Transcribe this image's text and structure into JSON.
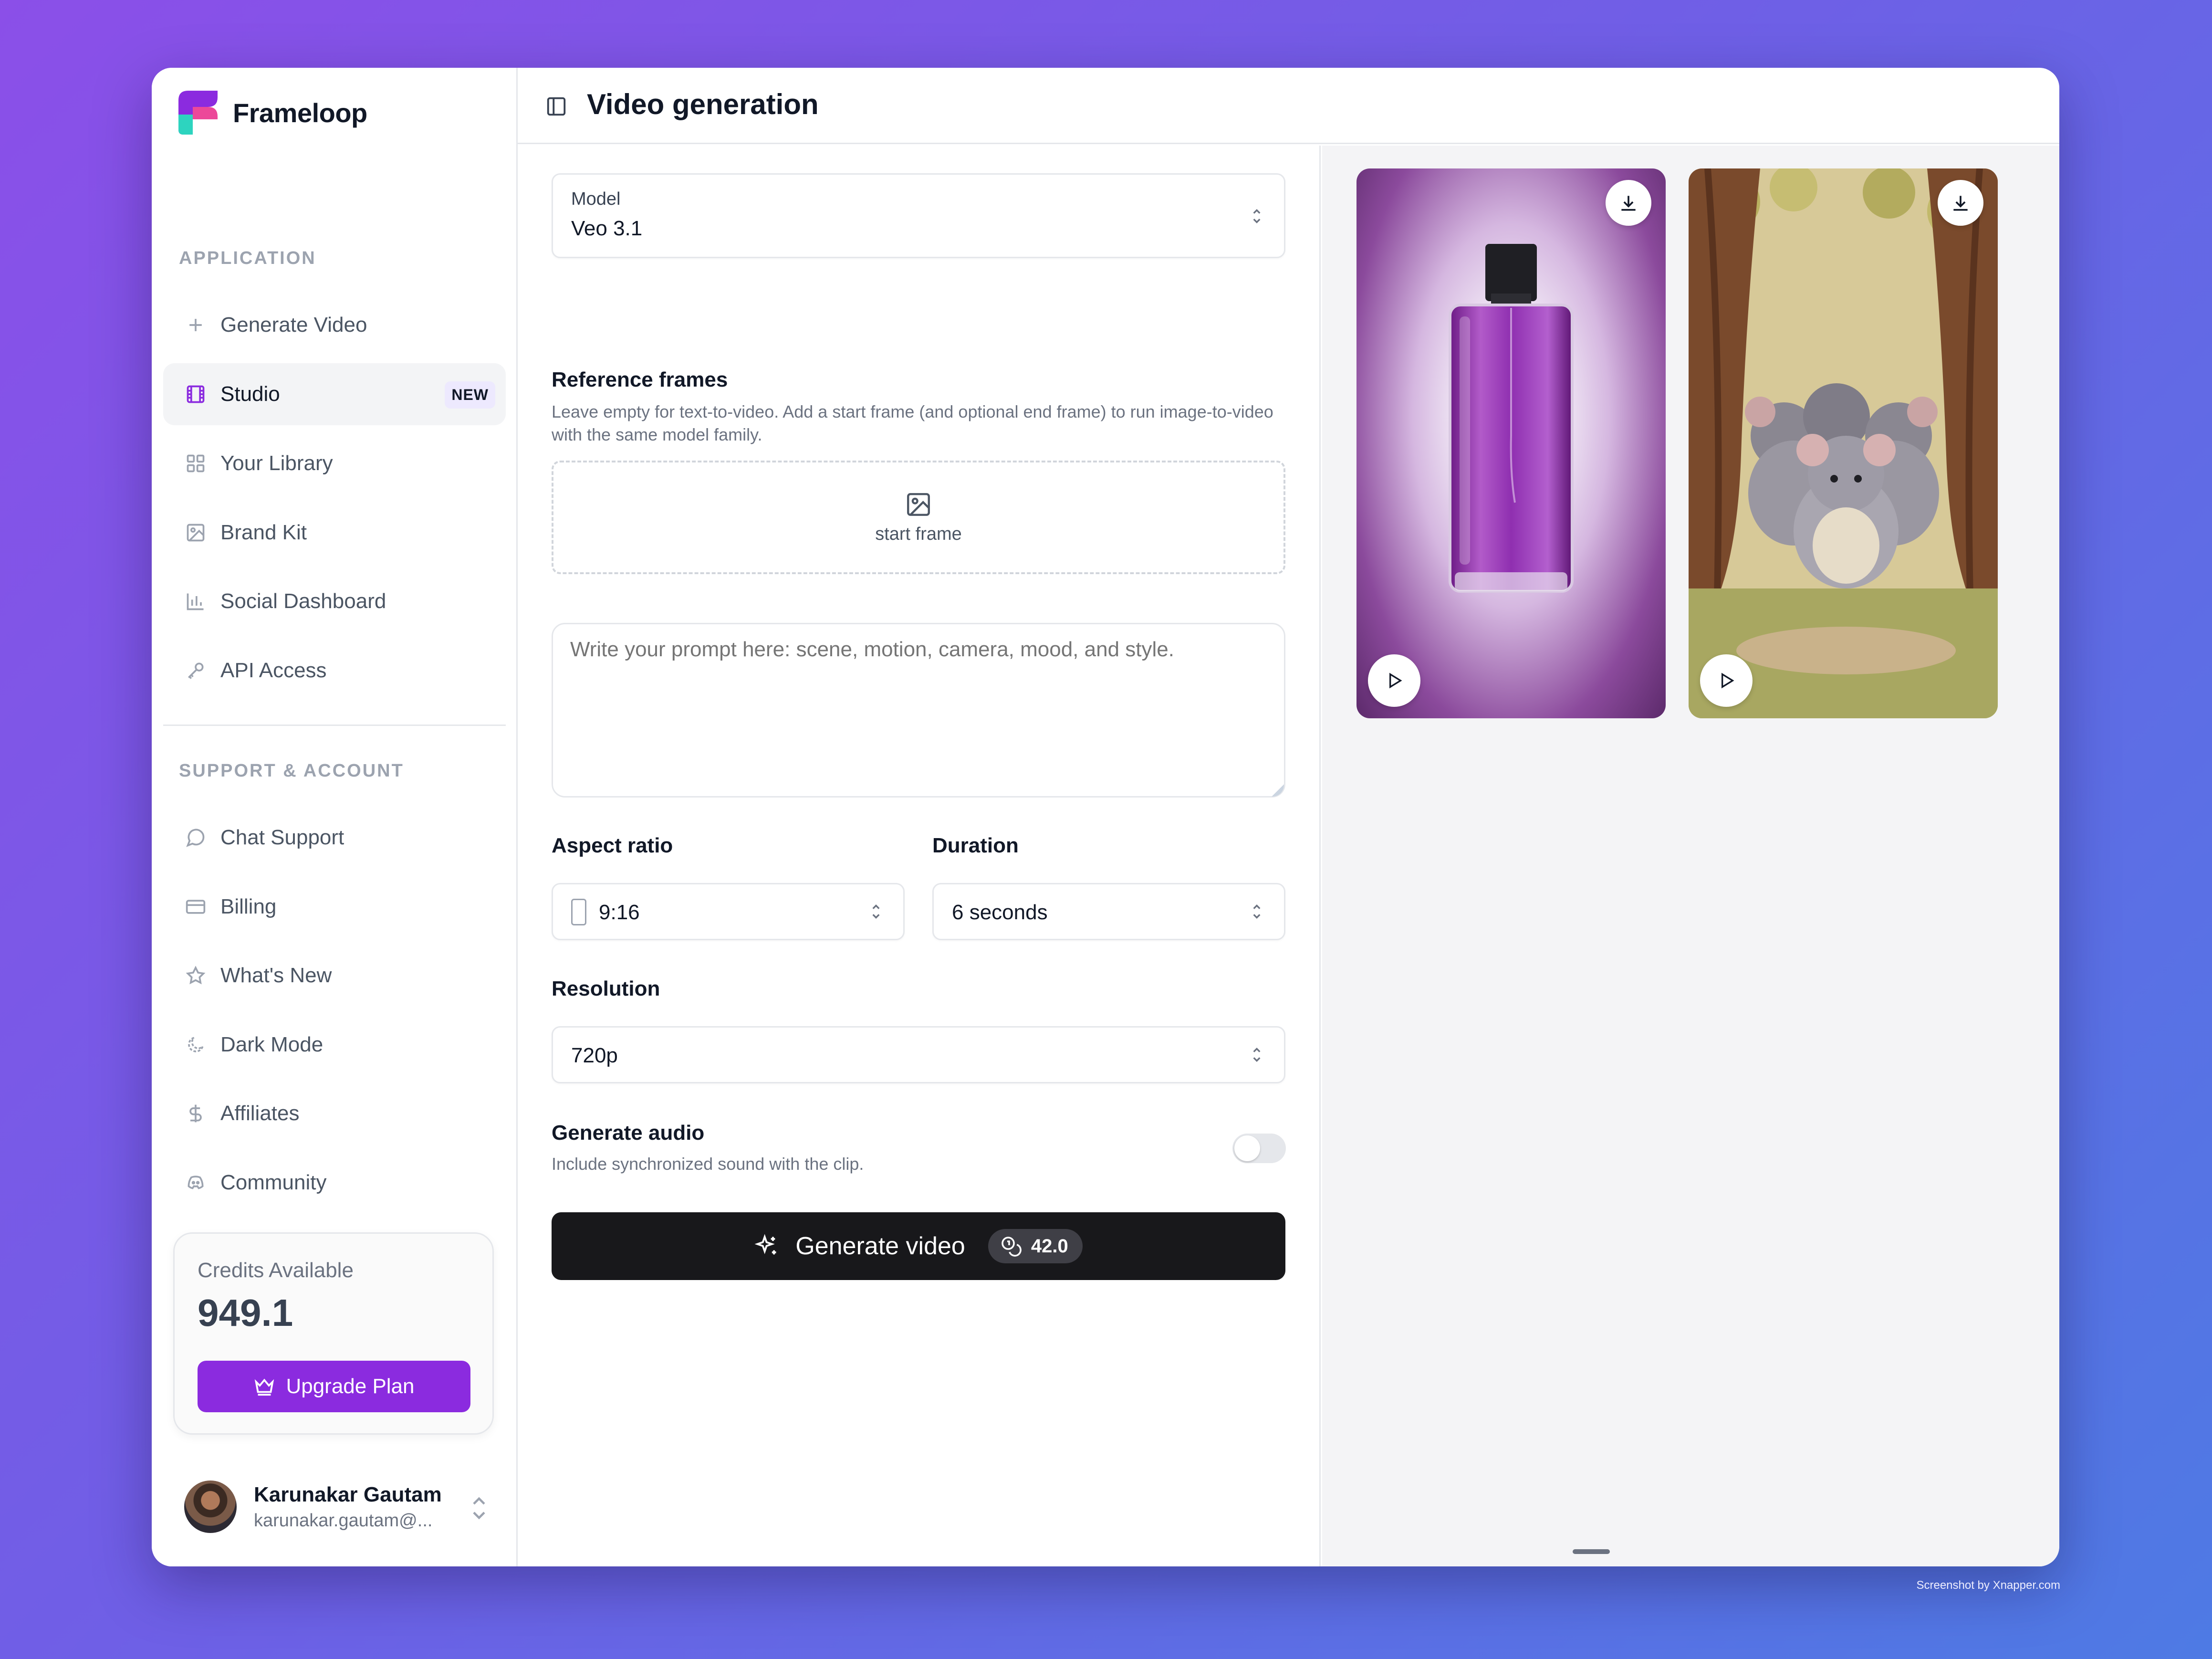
{
  "app": {
    "name": "Frameloop"
  },
  "sidebar": {
    "application_label": "APPLICATION",
    "items": [
      {
        "label": "Generate Video",
        "icon": "plus-icon"
      },
      {
        "label": "Studio",
        "icon": "film-icon",
        "badge": "NEW"
      },
      {
        "label": "Your Library",
        "icon": "grid-icon"
      },
      {
        "label": "Brand Kit",
        "icon": "image-icon"
      },
      {
        "label": "Social Dashboard",
        "icon": "bar-chart-icon"
      },
      {
        "label": "API Access",
        "icon": "key-icon"
      }
    ],
    "support_label": "SUPPORT & ACCOUNT",
    "support_items": [
      {
        "label": "Chat Support",
        "icon": "chat-icon"
      },
      {
        "label": "Billing",
        "icon": "credit-card-icon"
      },
      {
        "label": "What's New",
        "icon": "star-icon"
      },
      {
        "label": "Dark Mode",
        "icon": "moon-icon"
      },
      {
        "label": "Affiliates",
        "icon": "dollar-icon"
      },
      {
        "label": "Community",
        "icon": "discord-icon"
      }
    ],
    "credits": {
      "label": "Credits Available",
      "value": "949.1",
      "upgrade_label": "Upgrade Plan"
    },
    "user": {
      "name": "Karunakar Gautam",
      "email": "karunakar.gautam@..."
    }
  },
  "header": {
    "title": "Video generation"
  },
  "form": {
    "model": {
      "label": "Model",
      "value": "Veo 3.1"
    },
    "reference": {
      "title": "Reference frames",
      "help": "Leave empty for text-to-video. Add a start frame (and optional end frame) to run image-to-video with the same model family.",
      "dropzone_label": "start frame"
    },
    "prompt": {
      "placeholder": "Write your prompt here: scene, motion, camera, mood, and style."
    },
    "aspect_ratio": {
      "label": "Aspect ratio",
      "value": "9:16"
    },
    "duration": {
      "label": "Duration",
      "value": "6 seconds"
    },
    "resolution": {
      "label": "Resolution",
      "value": "720p"
    },
    "audio": {
      "label": "Generate audio",
      "help": "Include synchronized sound with the clip.",
      "enabled": false
    },
    "generate": {
      "label": "Generate video",
      "cost": "42.0"
    }
  },
  "colors": {
    "accent": "#8b2bdf",
    "primary_button": "#18181b"
  },
  "footer": {
    "credit": "Screenshot by Xnapper.com"
  }
}
